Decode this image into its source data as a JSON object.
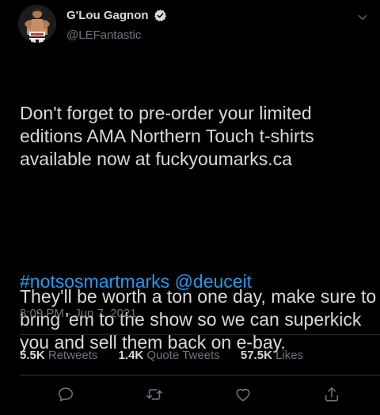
{
  "author": {
    "display_name": "G'Lou Gagnon",
    "handle": "@LEFantastic",
    "verified_icon": "verified-badge-icon",
    "menu_icon": "chevron-down-icon"
  },
  "tweet": {
    "paragraph_1": "Don't forget to pre-order your limited editions AMA Northern Touch t-shirts available now at fuckyoumarks.ca",
    "paragraph_2": "They'll be worth a ton one day, make sure to bring 'em to the show so we can superkick you and sell them back on e-bay.",
    "hashtag": "#notsosmartmarks",
    "mention": "@deuceit"
  },
  "timestamp": {
    "time": "8:09 PM",
    "separator": " · ",
    "date": "Jun 7, 2021"
  },
  "stats": {
    "retweets_count": "5.5K",
    "retweets_label": "Retweets",
    "quotes_count": "1.4K",
    "quotes_label": "Quote Tweets",
    "likes_count": "57.5K",
    "likes_label": "Likes"
  },
  "actions": [
    "reply-icon",
    "retweet-icon",
    "like-icon",
    "share-icon"
  ],
  "colors": {
    "background": "#000000",
    "text": "#d9d9d9",
    "muted": "#6e767d",
    "link": "#1d9bf0",
    "divider": "#2f3336"
  }
}
